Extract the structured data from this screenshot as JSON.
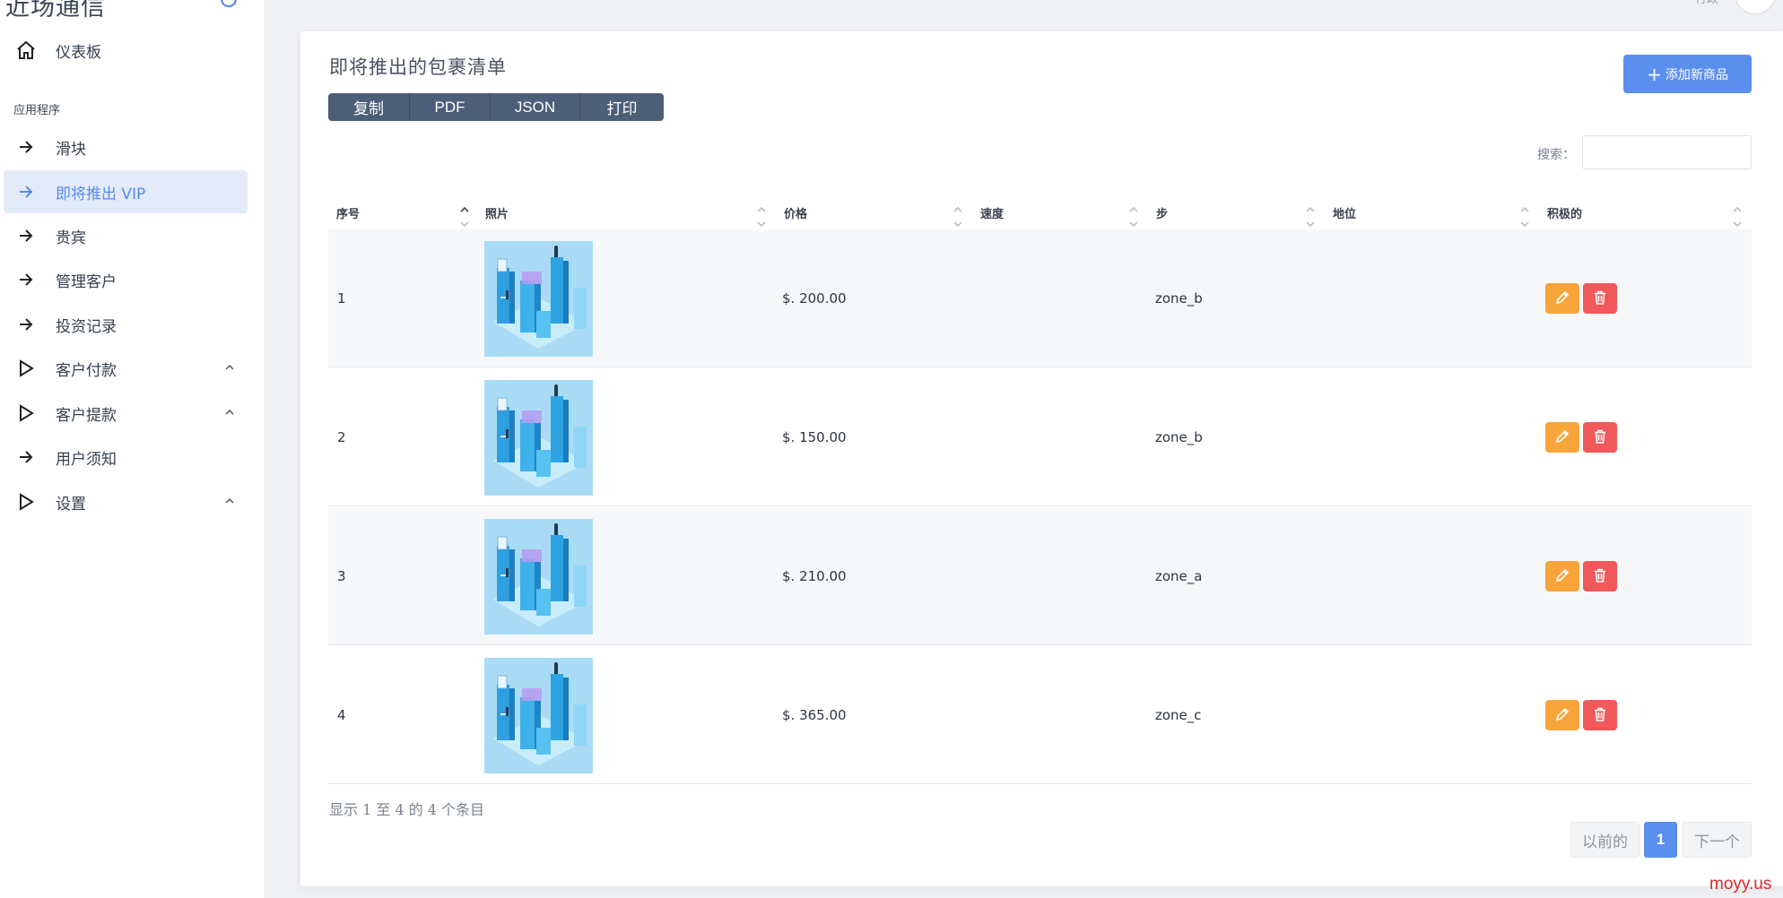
{
  "app": {
    "brand": "近场通信"
  },
  "sidebar": {
    "dashboard": "仪表板",
    "section_label": "应用程序",
    "items": [
      {
        "label": "滑块",
        "icon": "arrow-right-icon"
      },
      {
        "label": "即将推出 VIP",
        "icon": "arrow-right-icon",
        "active": true
      },
      {
        "label": "贵宾",
        "icon": "arrow-right-icon"
      },
      {
        "label": "管理客户",
        "icon": "arrow-right-icon"
      },
      {
        "label": "投资记录",
        "icon": "arrow-right-icon"
      },
      {
        "label": "客户付款",
        "icon": "play-triangle-icon",
        "expandable": true
      },
      {
        "label": "客户提款",
        "icon": "play-triangle-icon",
        "expandable": true
      },
      {
        "label": "用户须知",
        "icon": "arrow-right-icon"
      },
      {
        "label": "设置",
        "icon": "play-triangle-icon",
        "expandable": true
      }
    ]
  },
  "topbar": {
    "user_text": "行政"
  },
  "main": {
    "title": "即将推出的包裹清单",
    "add_button": "添加新商品",
    "export_buttons": [
      "复制",
      "PDF",
      "JSON",
      "打印"
    ],
    "search_label": "搜索：",
    "search_value": "",
    "columns": [
      "序号",
      "照片",
      "价格",
      "速度",
      "步",
      "地位",
      "积极的"
    ],
    "rows": [
      {
        "num": "1",
        "price": "$. 200.00",
        "speed": "",
        "zone": "zone_b",
        "status": ""
      },
      {
        "num": "2",
        "price": "$. 150.00",
        "speed": "",
        "zone": "zone_b",
        "status": ""
      },
      {
        "num": "3",
        "price": "$. 210.00",
        "speed": "",
        "zone": "zone_a",
        "status": ""
      },
      {
        "num": "4",
        "price": "$. 365.00",
        "speed": "",
        "zone": "zone_c",
        "status": ""
      }
    ],
    "info": "显示 1 至 4 的 4 个条目",
    "pagination": {
      "prev": "以前的",
      "current": "1",
      "next": "下一个"
    }
  },
  "watermark": "moyy.us",
  "colors": {
    "accent": "#5b8fee",
    "edit": "#f7a53a",
    "delete": "#f1585a",
    "export_buttons": "#4d5f78",
    "active_nav_bg": "#e3ebfb"
  }
}
